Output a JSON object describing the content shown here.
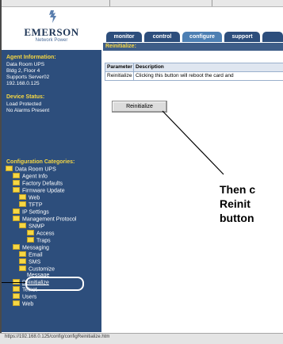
{
  "brand": {
    "name": "EMERSON",
    "tagline": "Network Power"
  },
  "agent_info": {
    "title": "Agent Information:",
    "lines": [
      "Data Room UPS",
      "Bldg 2, Floor 4",
      "Supports Server02",
      "192.168.0.125"
    ]
  },
  "device_status": {
    "title": "Device Status:",
    "lines": [
      "Load Protected",
      "No Alarms Present"
    ]
  },
  "categories": {
    "title": "Configuration Categories:",
    "items": [
      {
        "label": "Data Room UPS",
        "level": 0
      },
      {
        "label": "Agent Info",
        "level": 1
      },
      {
        "label": "Factory Defaults",
        "level": 1
      },
      {
        "label": "Firmware Update",
        "level": 1
      },
      {
        "label": "Web",
        "level": 2
      },
      {
        "label": "TFTP",
        "level": 2
      },
      {
        "label": "IP Settings",
        "level": 1
      },
      {
        "label": "Management Protocol",
        "level": 1
      },
      {
        "label": "SNMP",
        "level": 2
      },
      {
        "label": "Access",
        "level": 3
      },
      {
        "label": "Traps",
        "level": 3
      },
      {
        "label": "Messaging",
        "level": 1
      },
      {
        "label": "Email",
        "level": 2
      },
      {
        "label": "SMS",
        "level": 2
      },
      {
        "label": "Customize",
        "level": 2
      },
      {
        "label": "Message",
        "level": 2
      },
      {
        "label": "Reinitialize",
        "level": 1,
        "selected": true
      },
      {
        "label": "Telnet",
        "level": 1
      },
      {
        "label": "Users",
        "level": 1
      },
      {
        "label": "Web",
        "level": 1
      }
    ]
  },
  "tabs": [
    "monitor",
    "control",
    "configure",
    "support"
  ],
  "active_tab": "configure",
  "content": {
    "header": "Reinitialize:",
    "table_headers": [
      "Parameter",
      "Description"
    ],
    "table_row": [
      "Reinitialize",
      "Clicking this button will reboot the card and"
    ],
    "button_label": "Reinitialize"
  },
  "annotation": {
    "lines": [
      "Then c",
      "Reinit",
      "button"
    ]
  },
  "status_bar": "https://192.168.0.125/config/configReinitialize.htm",
  "colors": {
    "sidebar_bg": "#2d4e7c",
    "accent_yellow": "#f6d743",
    "tab_active": "#4d7fb3"
  }
}
